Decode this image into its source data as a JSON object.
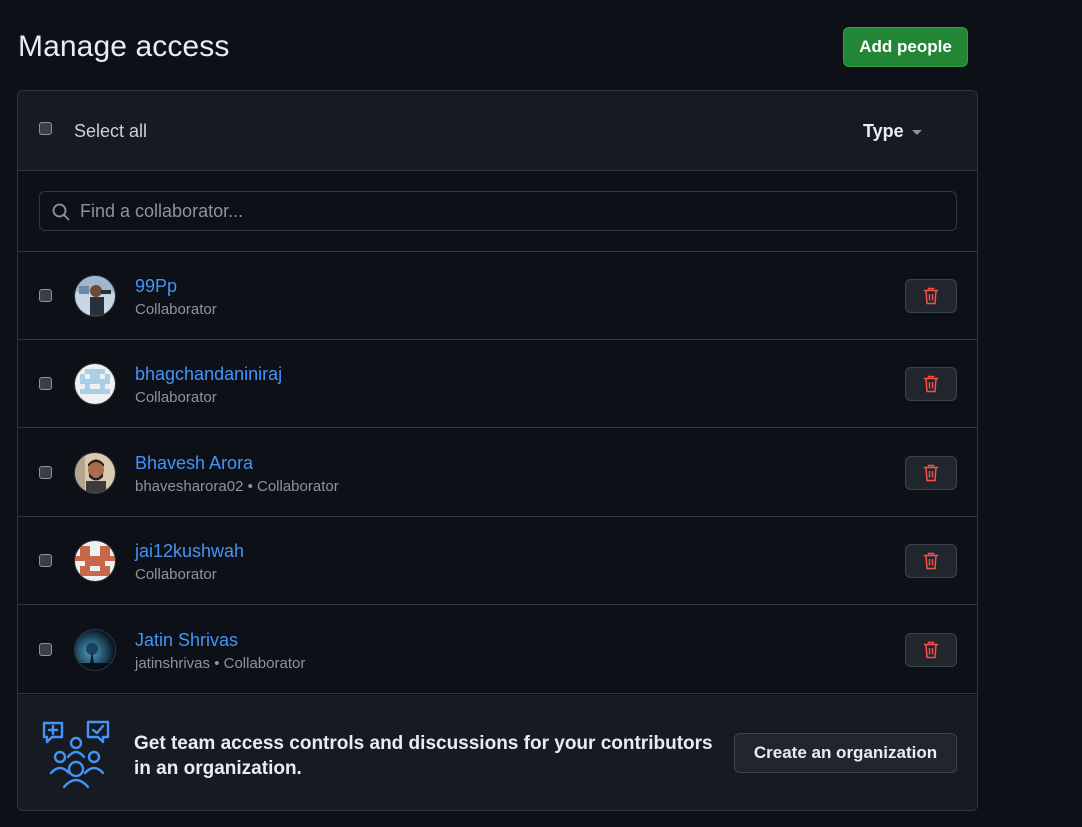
{
  "header": {
    "title": "Manage access",
    "add_people_label": "Add people"
  },
  "list_header": {
    "select_all_label": "Select all",
    "type_filter_label": "Type"
  },
  "search": {
    "placeholder": "Find a collaborator..."
  },
  "members": [
    {
      "name": "99Pp",
      "meta": "Collaborator"
    },
    {
      "name": "bhagchandaniniraj",
      "meta": "Collaborator"
    },
    {
      "name": "Bhavesh Arora",
      "meta": "bhavesharora02 • Collaborator"
    },
    {
      "name": "jai12kushwah",
      "meta": "Collaborator"
    },
    {
      "name": "Jatin Shrivas",
      "meta": "jatinshrivas • Collaborator"
    }
  ],
  "footer": {
    "message": "Get team access controls and discussions for your contributors in an organization.",
    "create_org_label": "Create an organization"
  },
  "colors": {
    "background": "#0d1117",
    "panel_header": "#161b22",
    "border": "#30363d",
    "primary_button": "#238636",
    "link": "#4493f8",
    "danger": "#f85149",
    "accent_icon": "#4493f8"
  },
  "icons": {
    "search": "search-icon",
    "delete": "trash-icon",
    "dropdown": "caret-down-icon",
    "organization": "people-icon"
  }
}
